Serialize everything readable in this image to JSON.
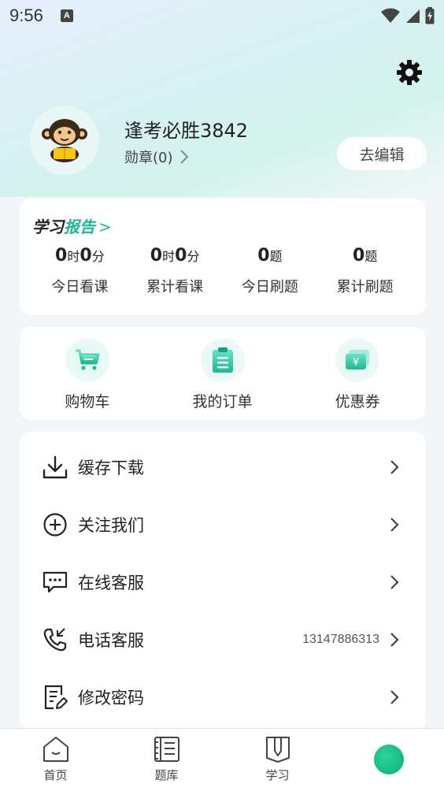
{
  "status_bar": {
    "time": "9:56",
    "notification_badge": "A"
  },
  "profile": {
    "username": "逢考必胜3842",
    "medal_text": "勋章(0)",
    "edit_button": "去编辑"
  },
  "report": {
    "title_part1": "学习",
    "title_part2": "报告",
    "title_arrow": ">",
    "stats": [
      {
        "h": "0",
        "h_unit": "时",
        "m": "0",
        "m_unit": "分",
        "label": "今日看课"
      },
      {
        "h": "0",
        "h_unit": "时",
        "m": "0",
        "m_unit": "分",
        "label": "累计看课"
      },
      {
        "count": "0",
        "unit": "题",
        "label": "今日刷题"
      },
      {
        "count": "0",
        "unit": "题",
        "label": "累计刷题"
      }
    ]
  },
  "shop": {
    "items": [
      {
        "label": "购物车",
        "icon": "cart-icon"
      },
      {
        "label": "我的订单",
        "icon": "order-clipboard-icon"
      },
      {
        "label": "优惠券",
        "icon": "coupon-yen-icon"
      }
    ]
  },
  "menu": {
    "items": [
      {
        "label": "缓存下载",
        "icon": "download-icon",
        "value": ""
      },
      {
        "label": "关注我们",
        "icon": "plus-circle-icon",
        "value": ""
      },
      {
        "label": "在线客服",
        "icon": "chat-icon",
        "value": ""
      },
      {
        "label": "电话客服",
        "icon": "phone-icon",
        "value": "13147886313"
      },
      {
        "label": "修改密码",
        "icon": "edit-document-icon",
        "value": ""
      }
    ]
  },
  "bottom_nav": {
    "items": [
      {
        "label": "首页",
        "icon": "home-icon"
      },
      {
        "label": "题库",
        "icon": "question-bank-icon"
      },
      {
        "label": "学习",
        "icon": "study-icon"
      },
      {
        "label": "",
        "icon": "profile-active-icon"
      }
    ]
  },
  "colors": {
    "accent": "#20b59a",
    "active_nav": "#12b57d"
  }
}
